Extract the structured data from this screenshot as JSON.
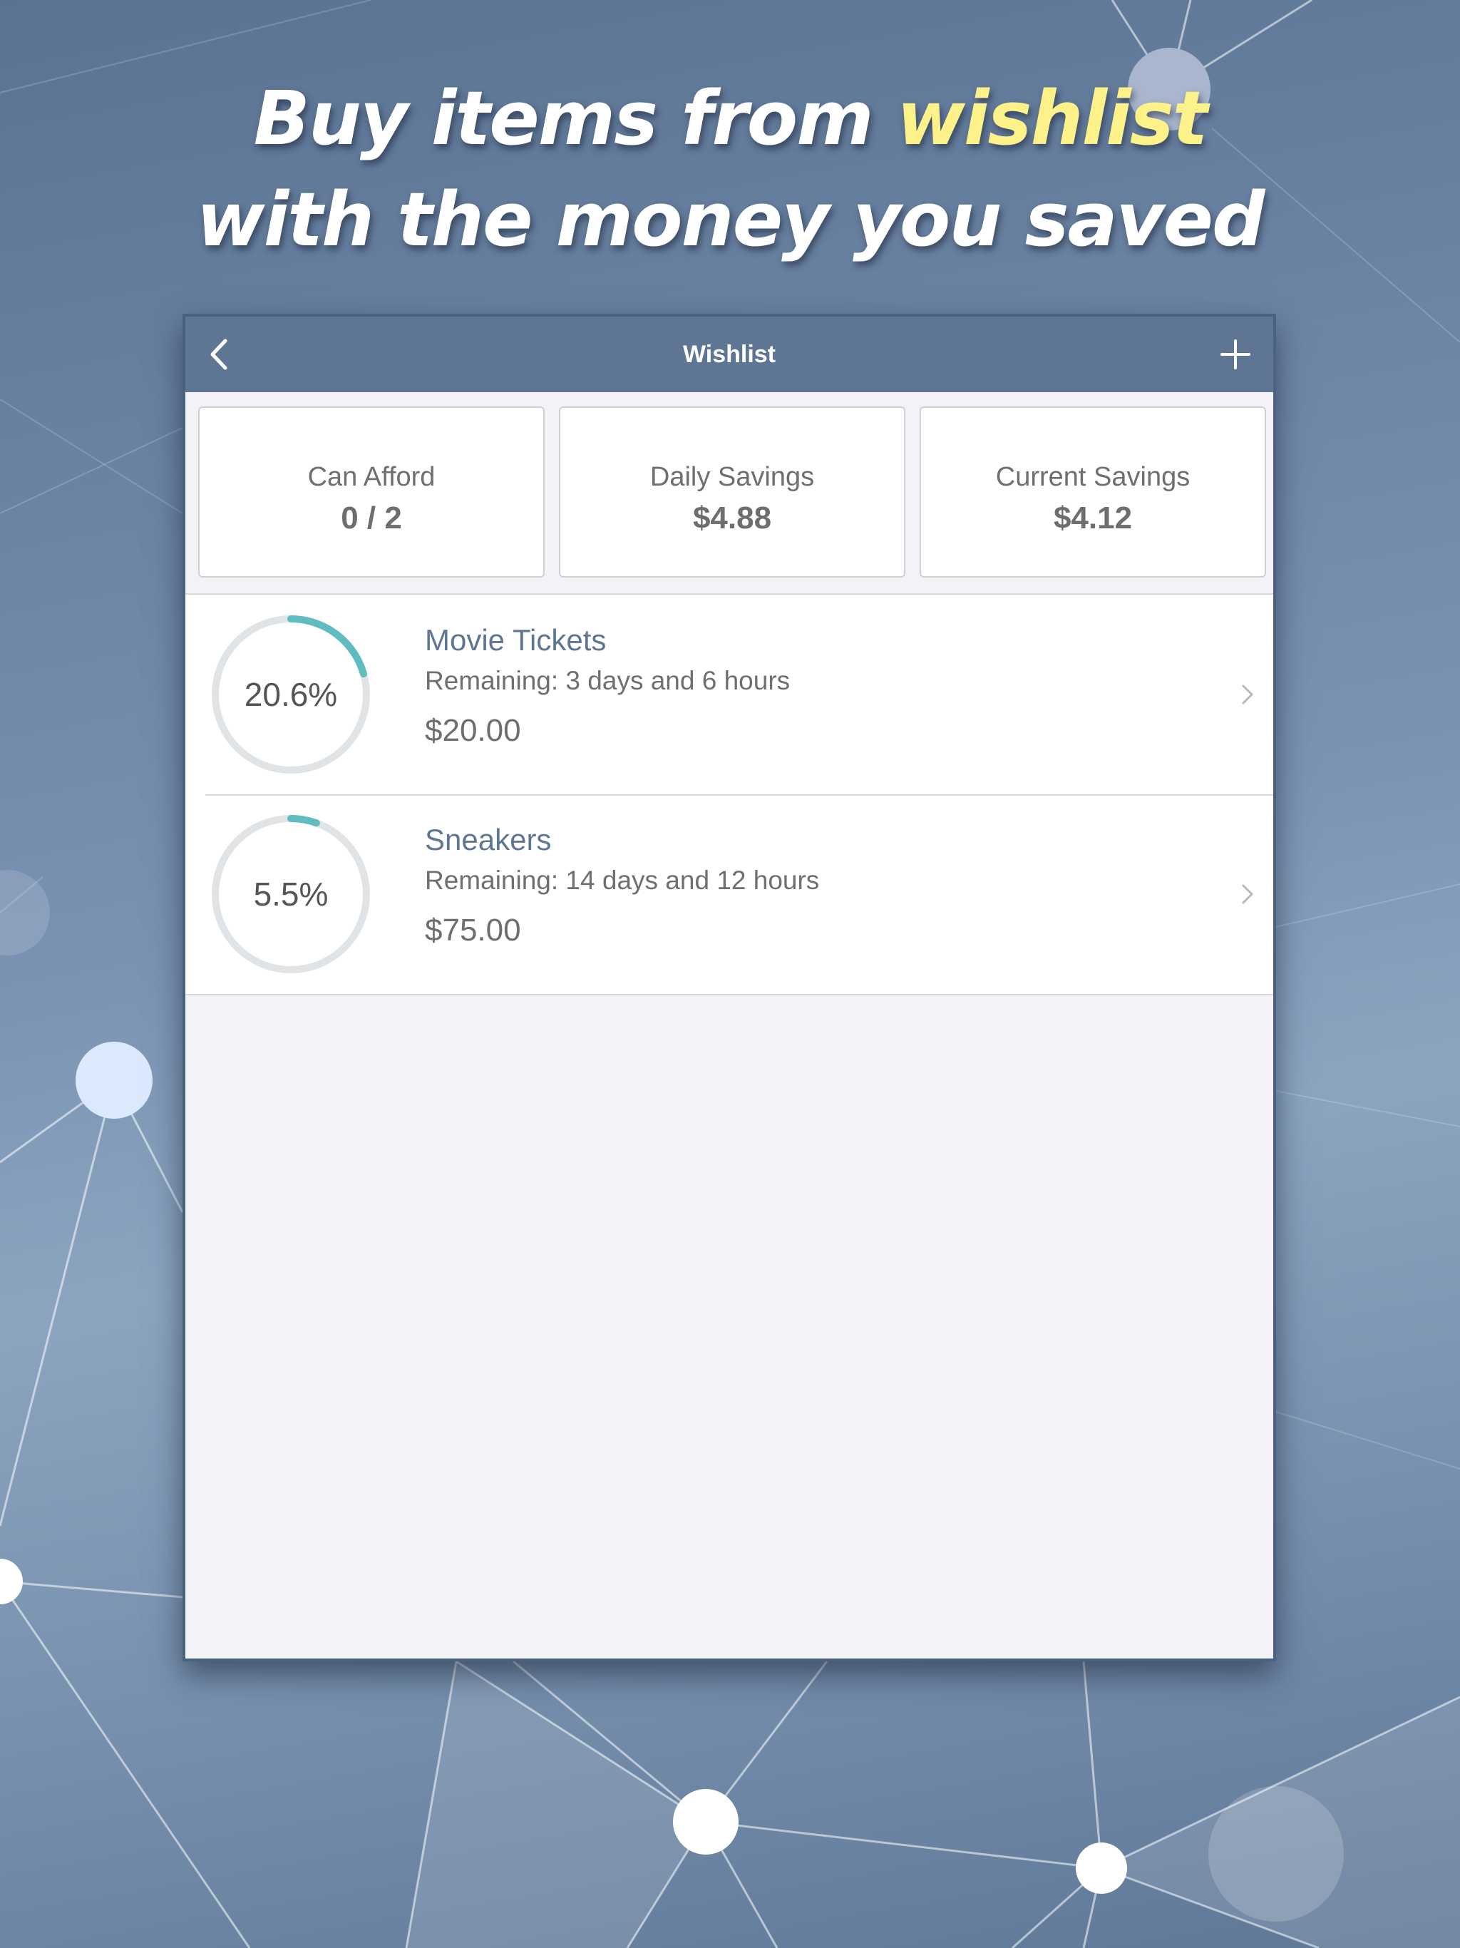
{
  "headline": {
    "line1_prefix": "Buy items from ",
    "line1_accent": "wishlist",
    "line2": "with the money you saved"
  },
  "navbar": {
    "title": "Wishlist",
    "back_icon": "chevron-left-icon",
    "add_icon": "plus-icon"
  },
  "stats": [
    {
      "label": "Can Afford",
      "value": "0 / 2"
    },
    {
      "label": "Daily Savings",
      "value": "$4.88"
    },
    {
      "label": "Current Savings",
      "value": "$4.12"
    }
  ],
  "items": [
    {
      "name": "Movie Tickets",
      "remaining": "Remaining: 3 days and 6 hours",
      "price": "$20.00",
      "percent_label": "20.6%",
      "progress": 0.206
    },
    {
      "name": "Sneakers",
      "remaining": "Remaining: 14 days and 12 hours",
      "price": "$75.00",
      "percent_label": "5.5%",
      "progress": 0.055
    }
  ],
  "colors": {
    "accent": "#fdf28a",
    "nav": "#5e7693",
    "ring_progress": "#5fbcc0",
    "ring_track": "#e1e4e6"
  }
}
